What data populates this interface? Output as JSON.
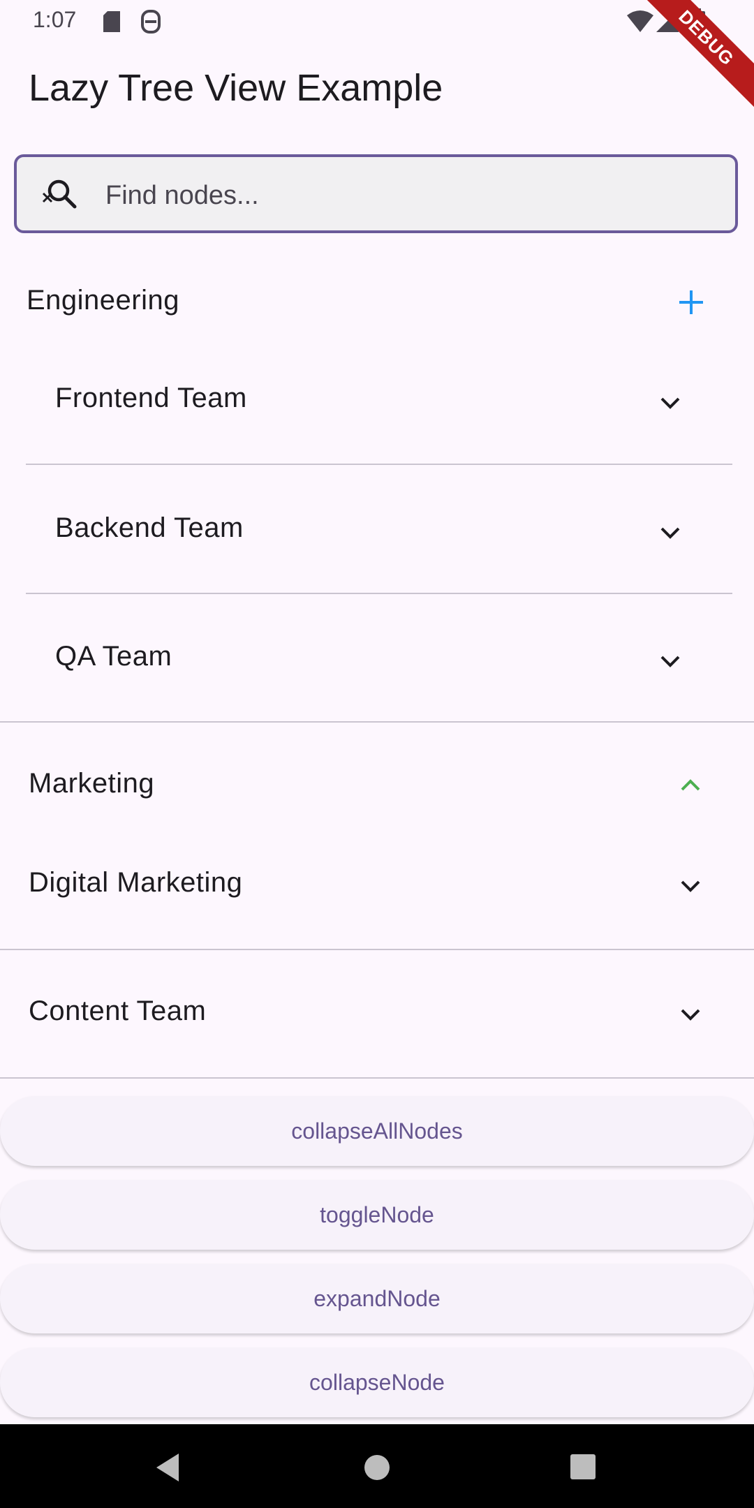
{
  "status_bar": {
    "time": "1:07",
    "icons": [
      "sd-card-icon",
      "assistant-icon",
      "wifi-icon",
      "signal-icon",
      "battery-icon"
    ]
  },
  "debug_banner": "DEBUG",
  "app_bar": {
    "title": "Lazy Tree View Example"
  },
  "search": {
    "placeholder": "Find nodes...",
    "value": ""
  },
  "tree": {
    "groups": [
      {
        "label": "Engineering",
        "icon": "plus-icon",
        "icon_color": "#2196f3",
        "children": [
          {
            "label": "Frontend Team",
            "icon": "chevron-down-icon"
          },
          {
            "label": "Backend Team",
            "icon": "chevron-down-icon"
          },
          {
            "label": "QA Team",
            "icon": "chevron-down-icon"
          }
        ]
      },
      {
        "label": "Marketing",
        "icon": "chevron-up-icon",
        "icon_color": "#4caf50",
        "children": [
          {
            "label": "Digital Marketing",
            "icon": "chevron-down-icon"
          },
          {
            "label": "Content Team",
            "icon": "chevron-down-icon"
          }
        ]
      }
    ]
  },
  "actions": [
    {
      "label": "collapseAllNodes"
    },
    {
      "label": "toggleNode"
    },
    {
      "label": "expandNode"
    },
    {
      "label": "collapseNode"
    }
  ],
  "colors": {
    "background": "#fdf7fe",
    "accent": "#65558f",
    "search_border": "#6a5a9a",
    "expand_icon_blue": "#2196f3",
    "collapse_icon_green": "#4caf50"
  },
  "nav_bar": {
    "buttons": [
      "back-icon",
      "home-icon",
      "recents-icon"
    ]
  }
}
